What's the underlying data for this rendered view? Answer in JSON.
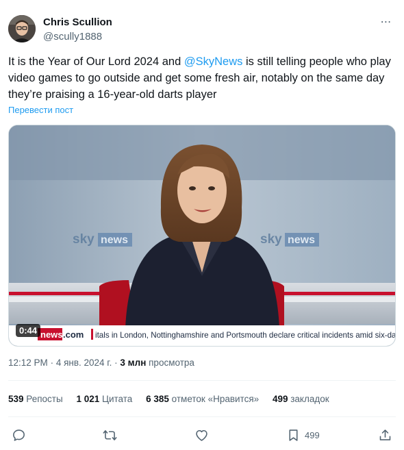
{
  "author": {
    "name": "Chris Scullion",
    "handle": "@scully1888"
  },
  "more_icon": "⋯",
  "tweet": {
    "text_before": "It is the Year of Our Lord 2024 and ",
    "mention": "@SkyNews",
    "text_after": " is still telling people who play video games to go outside and get some fresh air, notably on the same day they’re praising a 16-year-old darts player",
    "translate_label": "Перевести пост"
  },
  "media": {
    "duration": "0:44",
    "logo_left": "sky",
    "logo_left_box": "news",
    "logo_right": "sky",
    "logo_right_box": "news",
    "ticker_brand": "news",
    "ticker_domain": ".com",
    "ticker_text": "itals in London, Nottinghamshire and Portsmouth declare critical incidents amid six-day"
  },
  "meta": {
    "time": "12:12 PM",
    "separator": "·",
    "date": "4 янв. 2024 г.",
    "views_count": "3 млн",
    "views_label": "просмотра"
  },
  "stats": {
    "reposts_count": "539",
    "reposts_label": "Репосты",
    "quotes_count": "1 021",
    "quotes_label": "Цитата",
    "likes_count": "6 385",
    "likes_label": "отметок «Нравится»",
    "bookmarks_count": "499",
    "bookmarks_label": "закладок"
  },
  "actions": {
    "bookmark_count": "499"
  },
  "colors": {
    "accent": "#1d9bf0",
    "secondary_text": "#536471",
    "primary_text": "#0f1419",
    "sky_red": "#d0021b"
  }
}
